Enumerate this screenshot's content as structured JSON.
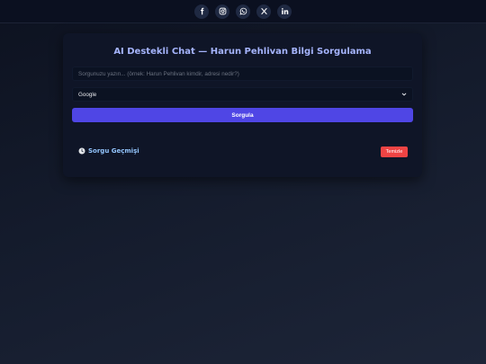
{
  "social": [
    {
      "icon": "facebook-icon"
    },
    {
      "icon": "instagram-icon"
    },
    {
      "icon": "whatsapp-icon"
    },
    {
      "icon": "x-icon"
    },
    {
      "icon": "linkedin-icon"
    }
  ],
  "card": {
    "title": "AI Destekli Chat — Harun Pehlivan Bilgi Sorgulama",
    "query_input": {
      "value": "",
      "placeholder": "Sorgunuzu yazın... (örnek: Harun Pehlivan kimdir, adresi nedir?)"
    },
    "engine_select": {
      "selected": "Google"
    },
    "submit_label": "Sorgula",
    "history_label": "Sorgu Geçmişi",
    "clear_label": "Temizle"
  },
  "colors": {
    "accent": "#4f46e5",
    "title": "#a5b4fc",
    "history": "#93c5fd",
    "danger": "#ef4444"
  }
}
